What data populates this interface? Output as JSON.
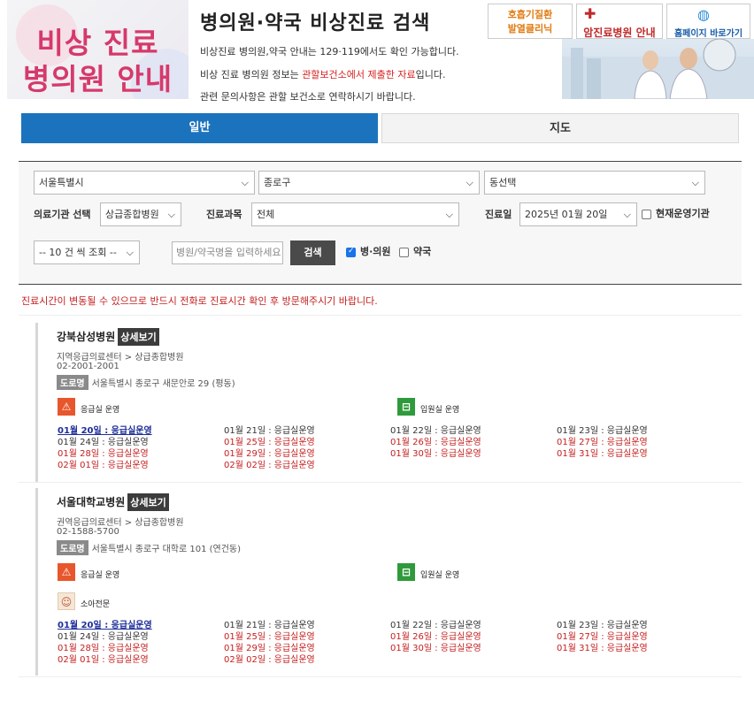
{
  "header": {
    "logo_line1": "비상 진료",
    "logo_line2": "병의원 안내",
    "title": "병의원·약국 비상진료 검색",
    "desc1": "비상진료 병의원,약국 안내는 129·119에서도 확인 가능합니다.",
    "desc2_a": "비상 진료 병의원 정보는 ",
    "desc2_b": "관할보건소에서 제출한 자료",
    "desc2_c": "입니다.",
    "desc3": "관련 문의사항은 관할 보건소로 연락하시기 바랍니다.",
    "banner1_line1": "호흡기질환",
    "banner1_line2": "발열클리닉",
    "banner2": "암진료병원 안내",
    "banner3": "홈페이지 바로가기"
  },
  "tabs": [
    {
      "label": "일반"
    },
    {
      "label": "지도"
    }
  ],
  "search": {
    "city": "서울특별시",
    "district": "종로구",
    "dong": "동선택",
    "type_label": "의료기관 선택",
    "type_value": "상급종합병원",
    "dept_label": "진료과목",
    "dept_value": "전체",
    "date_label": "진료일",
    "date_value": "2025년 01월 20일",
    "open_now_label": "현재운영기관",
    "page_size": "-- 10 건 씩 조회 --",
    "keyword_placeholder": "병원/약국명을 입력하세요",
    "search_button": "검색",
    "hospital_label": "병·의원",
    "pharmacy_label": "약국"
  },
  "notice": "진료시간이 변동될 수 있으므로 반드시 전화로 진료시간 확인 후 방문해주시기 바랍니다.",
  "results": [
    {
      "name": "강북삼성병원",
      "detail": "상세보기",
      "category": "지역응급의료센터 > 상급종합병원",
      "phone": "02-2001-2001",
      "road_tag": "도로명",
      "address": "서울특별시 종로구 새문안로 29 (평동)",
      "er_label": "응급실 운영",
      "ward_label": "입원실 운영",
      "schedule": [
        "01월 20일 : 응급실운영",
        "01월 21일 : 응급실운영",
        "01월 22일 : 응급실운영",
        "01월 23일 : 응급실운영",
        "01월 24일 : 응급실운영",
        "01월 25일 : 응급실운영",
        "01월 26일 : 응급실운영",
        "01월 27일 : 응급실운영",
        "01월 28일 : 응급실운영",
        "01월 29일 : 응급실운영",
        "01월 30일 : 응급실운영",
        "01월 31일 : 응급실운영",
        "02월 01일 : 응급실운영",
        "02월 02일 : 응급실운영"
      ]
    },
    {
      "name": "서울대학교병원",
      "detail": "상세보기",
      "category": "권역응급의료센터 > 상급종합병원",
      "phone": "02-1588-5700",
      "road_tag": "도로명",
      "address": "서울특별시 종로구 대학로 101 (연건동)",
      "er_label": "응급실 운영",
      "ward_label": "입원실 운영",
      "child_label": "소아전문",
      "schedule": [
        "01월 20일 : 응급실운영",
        "01월 21일 : 응급실운영",
        "01월 22일 : 응급실운영",
        "01월 23일 : 응급실운영",
        "01월 24일 : 응급실운영",
        "01월 25일 : 응급실운영",
        "01월 26일 : 응급실운영",
        "01월 27일 : 응급실운영",
        "01월 28일 : 응급실운영",
        "01월 29일 : 응급실운영",
        "01월 30일 : 응급실운영",
        "01월 31일 : 응급실운영",
        "02월 01일 : 응급실운영",
        "02월 02일 : 응급실운영"
      ]
    }
  ]
}
